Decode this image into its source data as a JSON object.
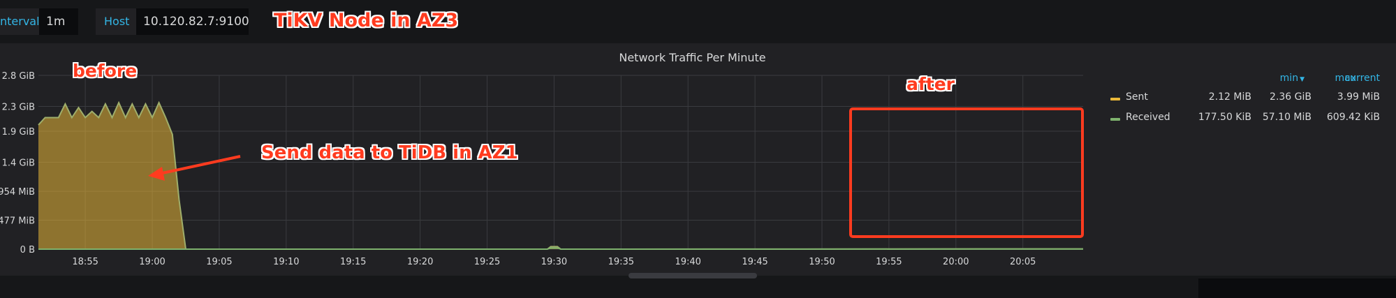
{
  "toolbar": {
    "interval_label": "nterval",
    "interval_value": "1m",
    "host_label": "Host",
    "host_value": "10.120.82.7:9100"
  },
  "annotations": {
    "node": "TiKV Node in AZ3",
    "before": "before",
    "after": "after",
    "send": "Send data to TiDB in AZ1"
  },
  "colors": {
    "sent": "#eab839",
    "received": "#7eb26d",
    "annotation": "#ff3b1f",
    "accent": "#33b5e5"
  },
  "legend": {
    "headers": {
      "min": "min",
      "max": "max",
      "current": "current"
    },
    "rows": [
      {
        "name": "Sent",
        "min": "2.12 MiB",
        "max": "2.36 GiB",
        "current": "3.99 MiB"
      },
      {
        "name": "Received",
        "min": "177.50 KiB",
        "max": "57.10 MiB",
        "current": "609.42 KiB"
      }
    ]
  },
  "chart_data": {
    "type": "area",
    "title": "Network Traffic Per Minute",
    "xlabel": "",
    "ylabel": "",
    "y_unit": "GiB",
    "ylim": [
      0,
      2.8
    ],
    "y_ticks": [
      {
        "value": 0,
        "label": "0 B"
      },
      {
        "value": 0.466,
        "label": "477 MiB"
      },
      {
        "value": 0.932,
        "label": "954 MiB"
      },
      {
        "value": 1.4,
        "label": "1.4 GiB"
      },
      {
        "value": 1.9,
        "label": "1.9 GiB"
      },
      {
        "value": 2.3,
        "label": "2.3 GiB"
      },
      {
        "value": 2.8,
        "label": "2.8 GiB"
      }
    ],
    "x_ticks": [
      "18:55",
      "19:00",
      "19:05",
      "19:10",
      "19:15",
      "19:20",
      "19:25",
      "19:30",
      "19:35",
      "19:40",
      "19:45",
      "19:50",
      "19:55",
      "20:00",
      "20:05"
    ],
    "x_range": [
      "18:51:30",
      "20:09:30"
    ],
    "grid": true,
    "legend_position": "right",
    "series": [
      {
        "name": "Sent",
        "points": [
          [
            "18:51:30",
            2.0
          ],
          [
            "18:52:00",
            2.12
          ],
          [
            "18:53:00",
            2.12
          ],
          [
            "18:53:30",
            2.34
          ],
          [
            "18:54:00",
            2.12
          ],
          [
            "18:54:30",
            2.28
          ],
          [
            "18:55:00",
            2.12
          ],
          [
            "18:55:30",
            2.22
          ],
          [
            "18:56:00",
            2.12
          ],
          [
            "18:56:30",
            2.34
          ],
          [
            "18:57:00",
            2.12
          ],
          [
            "18:57:30",
            2.36
          ],
          [
            "18:58:00",
            2.12
          ],
          [
            "18:58:30",
            2.34
          ],
          [
            "18:59:00",
            2.12
          ],
          [
            "18:59:30",
            2.34
          ],
          [
            "19:00:00",
            2.12
          ],
          [
            "19:00:30",
            2.36
          ],
          [
            "19:01:00",
            2.12
          ],
          [
            "19:01:30",
            1.85
          ],
          [
            "19:02:00",
            0.8
          ],
          [
            "19:02:30",
            0.0
          ],
          [
            "19:29:30",
            0.0
          ],
          [
            "19:29:45",
            0.04
          ],
          [
            "19:30:15",
            0.04
          ],
          [
            "19:30:30",
            0.0
          ],
          [
            "20:09:30",
            0.004
          ]
        ]
      },
      {
        "name": "Received",
        "points": [
          [
            "18:51:30",
            0.0001
          ],
          [
            "19:29:30",
            0.0001
          ],
          [
            "19:29:45",
            0.02
          ],
          [
            "19:30:15",
            0.02
          ],
          [
            "19:30:30",
            0.0001
          ],
          [
            "20:09:30",
            0.0006
          ]
        ]
      }
    ]
  }
}
